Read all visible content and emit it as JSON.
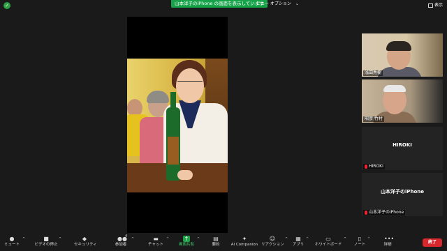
{
  "topbar": {
    "share_banner": "山本洋子のiPhone の画面を表示しています",
    "view_option": "ビュー オプション",
    "display_label": "表示"
  },
  "participants": [
    {
      "name": "浅田秀樹",
      "video": true,
      "muted": false,
      "active": false
    },
    {
      "name": "昭彦 竹村",
      "video": true,
      "muted": false,
      "active": true
    },
    {
      "name": "HIROKI",
      "display_name": "HIROKI",
      "video": false,
      "muted": true,
      "active": false
    },
    {
      "name": "山本洋子のiPhone",
      "display_name": "山本洋子のiPhone",
      "video": false,
      "muted": true,
      "active": false
    }
  ],
  "toolbar": {
    "mute": "ミュート",
    "stop_video": "ビデオの停止",
    "security": "セキュリティ",
    "participants": "参加者",
    "participants_count": "4",
    "chat": "チャット",
    "share_screen": "画面共有",
    "summary": "要約",
    "ai_companion": "AI Companion",
    "reactions": "リアクション",
    "apps": "アプリ",
    "whiteboard": "ホワイトボード",
    "notes": "ノート",
    "more": "詳細",
    "end": "終了"
  },
  "colors": {
    "share_green": "#17a34a",
    "active_speaker": "#c7e23b",
    "end_red": "#d9272e"
  }
}
